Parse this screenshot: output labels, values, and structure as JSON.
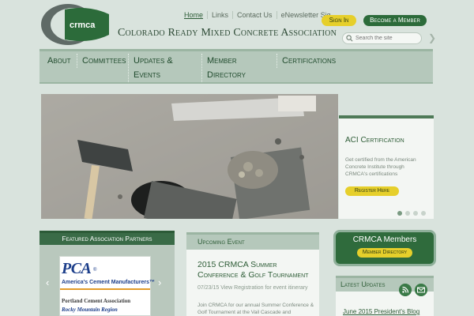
{
  "header": {
    "logo_text": "crmca",
    "org_name": "Colorado Ready Mixed Concrete Association",
    "top_links": [
      "Home",
      "Links",
      "Contact Us",
      "eNewsletter Sig"
    ],
    "sign_in": "Sign In",
    "become_member": "Become a Member",
    "search_placeholder": "Search the site"
  },
  "nav": {
    "items": [
      "About",
      "Committees",
      "Updates &",
      "Events",
      "Member",
      "Directory",
      "Certifications"
    ]
  },
  "hero": {
    "title": "ACI Certification",
    "text": "Get certified from the American Concrete Institute through CRMCA's certifications",
    "button": "Register Here",
    "slide_count": 4,
    "active_slide": 1
  },
  "partners": {
    "title": "Featured Association Partners",
    "logo_text": "PCA",
    "logo_reg": "®",
    "tagline": "America's Cement Manufacturers™",
    "line1": "Portland Cement Association",
    "line2": "Rocky Mountain Region",
    "prev": "‹",
    "next": "›"
  },
  "event": {
    "heading": "Upcoming Event",
    "title": "2015 CRMCA Summer Conference & Golf Tournament",
    "date": "07/23/15 View Registration for event itinerary",
    "desc": "Join CRMCA for our annual Summer Conference & Golf Tournament at the Vail Cascade and"
  },
  "members": {
    "title": "CRMCA Members",
    "button": "Member Directory"
  },
  "updates": {
    "title": "Latest Updates",
    "item": "June 2015 President's Blog"
  },
  "colors": {
    "primary_green": "#2c6b3a",
    "accent_yellow": "#e6cf2b",
    "nav_bg": "#b5c8bb"
  }
}
